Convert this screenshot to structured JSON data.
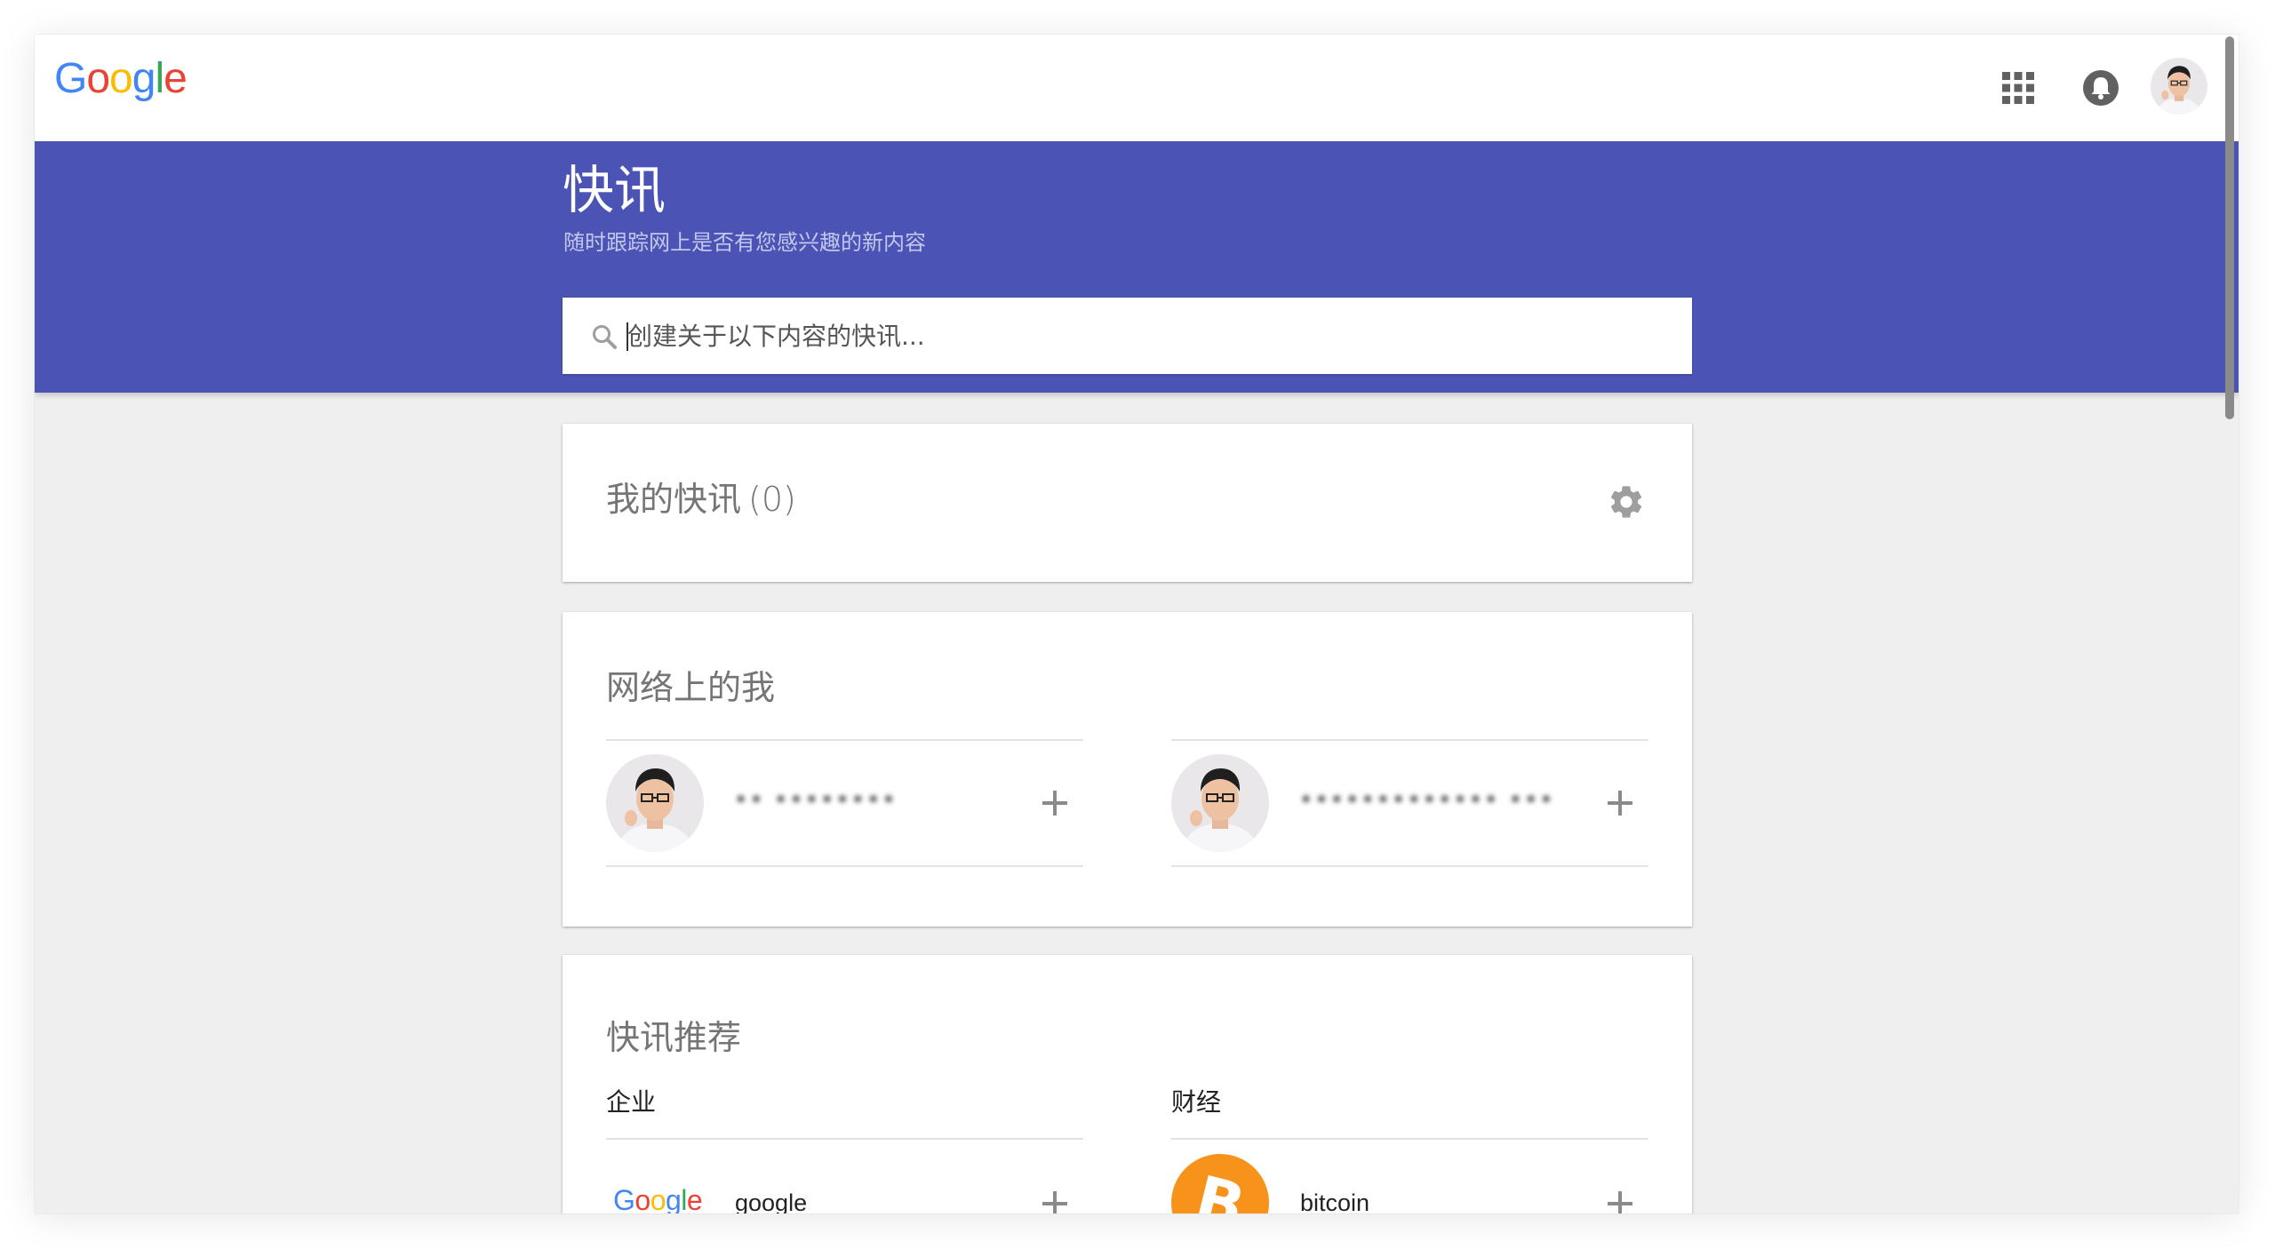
{
  "header": {
    "logo_letters": [
      "G",
      "o",
      "o",
      "g",
      "l",
      "e"
    ],
    "icons": [
      "apps-grid-icon",
      "notifications-bell-icon",
      "account-avatar"
    ]
  },
  "hero": {
    "title": "快讯",
    "subtitle": "随时跟踪网上是否有您感兴趣的新内容",
    "background_color": "#4b54b4"
  },
  "search": {
    "placeholder": "创建关于以下内容的快讯...",
    "value": ""
  },
  "my_alerts": {
    "title": "我的快讯",
    "count": "(0)"
  },
  "me_on_web": {
    "title": "网络上的我",
    "items": [
      {
        "name": "•• ••••••••"
      },
      {
        "name": "••••••••••••• •••"
      }
    ]
  },
  "suggestions": {
    "title": "快讯推荐",
    "categories": [
      {
        "label": "企业",
        "items": [
          {
            "logo_letters": [
              "G",
              "o",
              "o",
              "g",
              "l",
              "e"
            ],
            "name": "google"
          }
        ]
      },
      {
        "label": "财经",
        "items": [
          {
            "logo_symbol": "B",
            "logo_color": "#f7931a",
            "name": "bitcoin"
          }
        ]
      }
    ]
  }
}
